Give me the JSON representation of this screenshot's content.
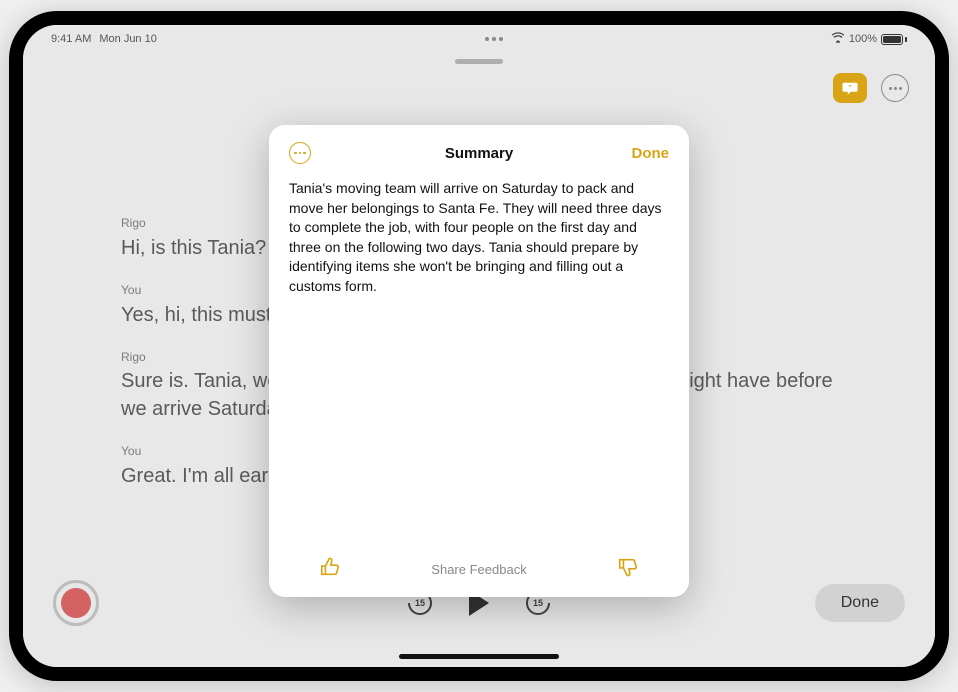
{
  "statusbar": {
    "time": "9:41 AM",
    "date": "Mon Jun 10",
    "battery_pct": "100%"
  },
  "top_tools": {
    "quote_icon": "transcript-quote",
    "more_icon": "more"
  },
  "transcript": [
    {
      "speaker": "Rigo",
      "text": "Hi, is this Tania?"
    },
    {
      "speaker": "You",
      "text": "Yes, hi, this must be l"
    },
    {
      "speaker": "Rigo",
      "text": "Sure is. Tania, we're a                                                                      o chat with you beforehand to go ove                                                                   u might have before we arrive Saturday m"
    },
    {
      "speaker": "You",
      "text": "Great. I'm all ears."
    }
  ],
  "player": {
    "skip_back": "15",
    "skip_fwd": "15",
    "done_label": "Done"
  },
  "modal": {
    "title": "Summary",
    "done_label": "Done",
    "body": "Tania's moving team will arrive on Saturday to pack and move her belongings to Santa Fe. They will need three days to complete the job, with four people on the first day and three on the following two days. Tania should prepare by identifying items she won't be bringing and filling out a customs form.",
    "feedback_label": "Share Feedback"
  },
  "colors": {
    "accent": "#d9a516"
  }
}
